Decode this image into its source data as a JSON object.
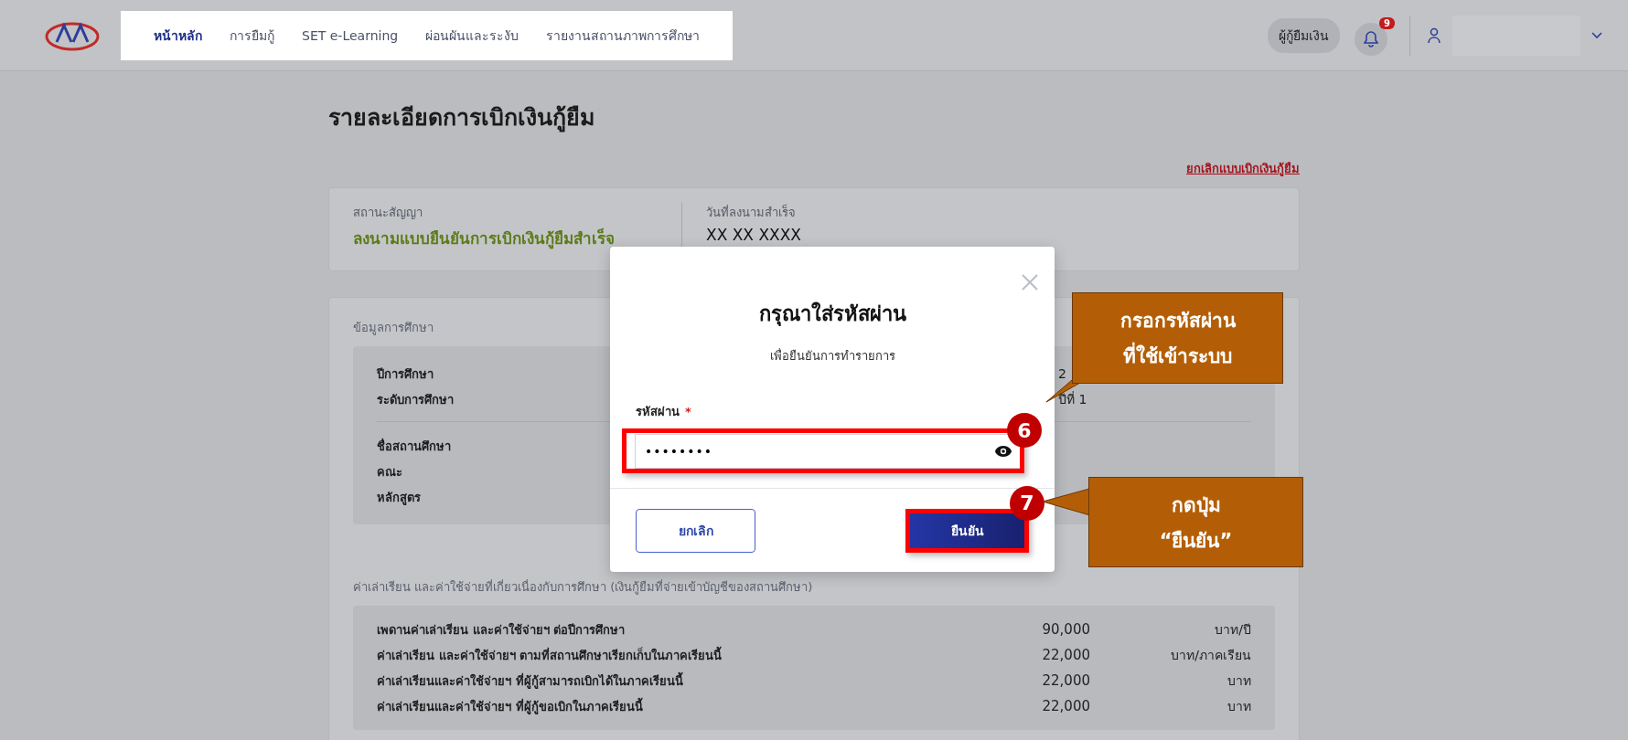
{
  "nav": {
    "links": [
      {
        "label": "หน้าหลัก",
        "selected": true
      },
      {
        "label": "การยืมกู้",
        "selected": false
      },
      {
        "label": "SET e-Learning",
        "selected": false
      },
      {
        "label": "ผ่อนผันและระงับ",
        "selected": false
      },
      {
        "label": "รายงานสถานภาพการศึกษา",
        "selected": false
      }
    ],
    "role_button": "ผู้กู้ยืมเงิน",
    "notification_count": "9"
  },
  "page": {
    "title": "รายละเอียดการเบิกเงินกู้ยืม",
    "cancel_link": "ยกเลิกแบบเบิกเงินกู้ยืม",
    "contract": [
      {
        "label": "สถานะสัญญา",
        "value": "ลงนามแบบยืนยันการเบิกเงินกู้ยืมสำเร็จ",
        "kind": "status"
      },
      {
        "label": "วันที่ลงนามสำเร็จ",
        "value": "XX XX XXXX",
        "kind": "plain"
      }
    ],
    "study": {
      "title": "ข้อมูลการศึกษา",
      "groups": [
        [
          {
            "label": "ปีการศึกษา",
            "value": "2"
          },
          {
            "label": "ระดับการศึกษา",
            "value": "ปีที่ 1"
          }
        ],
        [
          {
            "label": "ชื่อสถานศึกษา"
          },
          {
            "label": "คณะ"
          },
          {
            "label": "หลักสูตร"
          }
        ]
      ]
    },
    "fees": {
      "title": "ค่าเล่าเรียน และค่าใช้จ่ายที่เกี่ยวเนื่องกับการศึกษา (เงินกู้ยืมที่จ่ายเข้าบัญชีของสถานศึกษา)",
      "rows": [
        {
          "label": "เพดานค่าเล่าเรียน และค่าใช้จ่ายฯ ต่อปีการศึกษา",
          "amount": "90,000",
          "unit": "บาท/ปี"
        },
        {
          "label": "ค่าเล่าเรียน และค่าใช้จ่ายฯ ตามที่สถานศึกษาเรียกเก็บในภาคเรียนนี้",
          "amount": "22,000",
          "unit": "บาท/ภาคเรียน"
        },
        {
          "label": "ค่าเล่าเรียนและค่าใช้จ่ายฯ ที่ผู้กู้สามารถเบิกได้ในภาคเรียนนี้",
          "amount": "22,000",
          "unit": "บาท"
        },
        {
          "label": "ค่าเล่าเรียนและค่าใช้จ่ายฯ ที่ผู้กู้ขอเบิกในภาคเรียนนี้",
          "amount": "22,000",
          "unit": "บาท"
        }
      ]
    }
  },
  "modal": {
    "title": "กรุณาใส่รหัสผ่าน",
    "subtitle": "เพื่อยืนยันการทำรายการ",
    "field_label": "รหัสผ่าน",
    "required_mark": "*",
    "field_value": "••••••••",
    "cancel_button": "ยกเลิก",
    "confirm_button": "ยืนยัน"
  },
  "annotations": [
    {
      "number": "6",
      "lines": [
        "กรอกรหัสผ่าน",
        "ที่ใช้เข้าระบบ"
      ]
    },
    {
      "number": "7",
      "lines": [
        "กดปุ่ม",
        "“ยืนยัน”"
      ]
    }
  ]
}
